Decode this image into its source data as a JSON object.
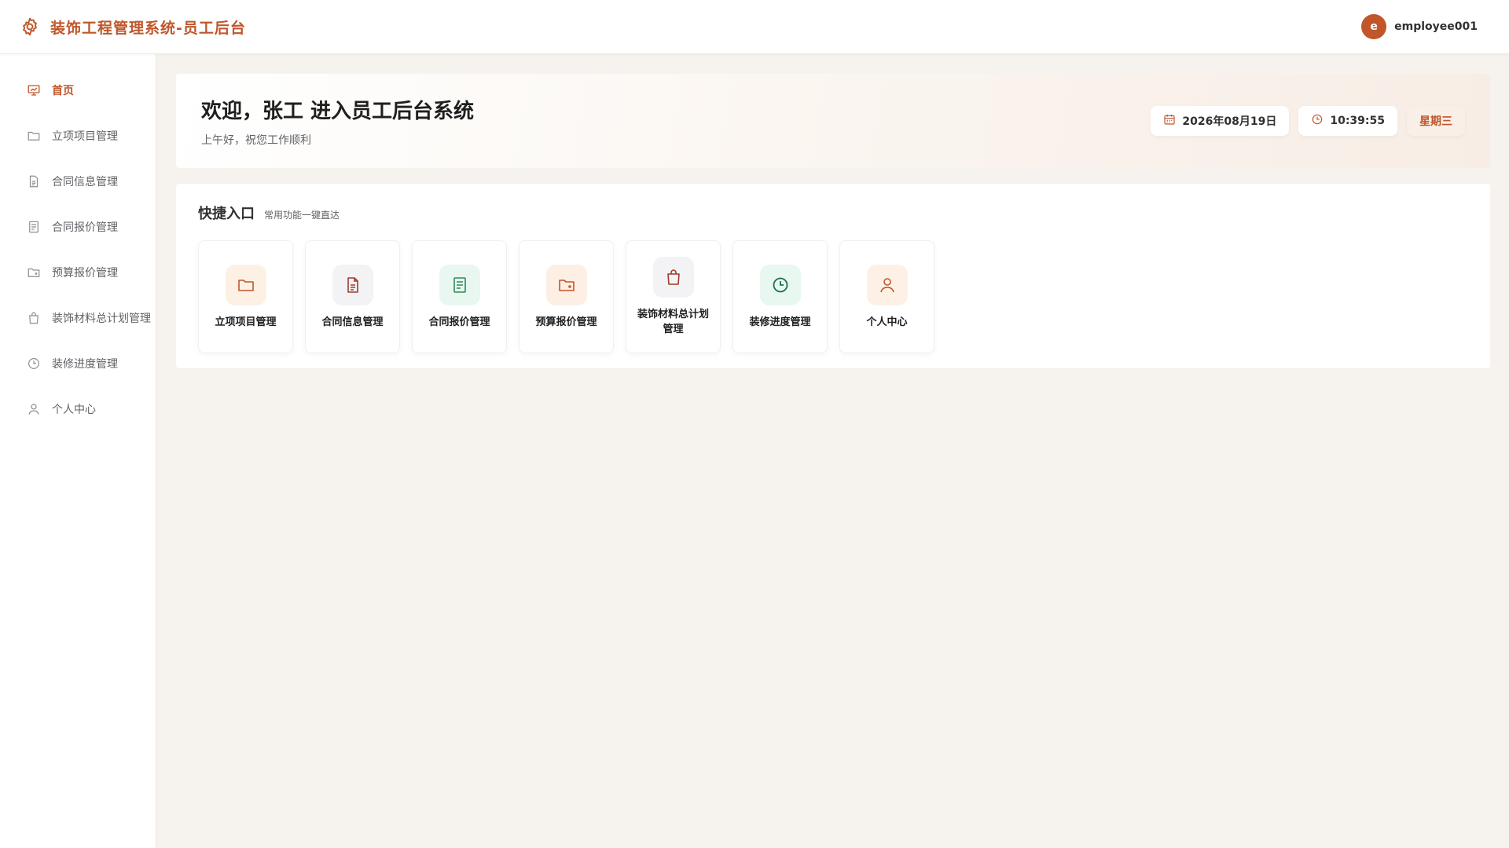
{
  "app": {
    "title": "装饰工程管理系统-员工后台"
  },
  "user": {
    "avatar_letter": "e",
    "name": "employee001"
  },
  "sidebar": {
    "items": [
      {
        "label": "首页",
        "icon": "presentation-icon",
        "active": true
      },
      {
        "label": "立项项目管理",
        "icon": "folder-icon"
      },
      {
        "label": "合同信息管理",
        "icon": "document-icon"
      },
      {
        "label": "合同报价管理",
        "icon": "list-document-icon"
      },
      {
        "label": "预算报价管理",
        "icon": "wallet-folder-icon"
      },
      {
        "label": "装饰材料总计划管理",
        "icon": "shopping-bag-icon"
      },
      {
        "label": "装修进度管理",
        "icon": "clock-icon"
      },
      {
        "label": "个人中心",
        "icon": "user-icon"
      }
    ]
  },
  "welcome": {
    "title": "欢迎，张工 进入员工后台系统",
    "subtitle": "上午好，祝您工作顺利",
    "date": "2026年08月19日",
    "time": "10:39:55",
    "weekday": "星期三"
  },
  "quick": {
    "title": "快捷入口",
    "subtitle": "常用功能一键直达",
    "cards": [
      {
        "label": "立项项目管理",
        "icon": "folder-icon",
        "tile_bg": "#fdf1e6",
        "icon_color": "#c0562a"
      },
      {
        "label": "合同信息管理",
        "icon": "document-icon",
        "tile_bg": "#f3f3f5",
        "icon_color": "#a23b2a"
      },
      {
        "label": "合同报价管理",
        "icon": "list-document-icon",
        "tile_bg": "#e8f7ef",
        "icon_color": "#2e8b57"
      },
      {
        "label": "预算报价管理",
        "icon": "wallet-folder-icon",
        "tile_bg": "#fdefe4",
        "icon_color": "#c0562a"
      },
      {
        "label": "装饰材料总计划管理",
        "icon": "shopping-bag-icon",
        "tile_bg": "#f3f3f5",
        "icon_color": "#a23b2a"
      },
      {
        "label": "装修进度管理",
        "icon": "clock-icon",
        "tile_bg": "#e8f7ef",
        "icon_color": "#1f6e4e"
      },
      {
        "label": "个人中心",
        "icon": "user-icon",
        "tile_bg": "#fdf1e6",
        "icon_color": "#c0562a"
      }
    ]
  },
  "colors": {
    "accent": "#c0562a",
    "background": "#f6f3ef"
  }
}
